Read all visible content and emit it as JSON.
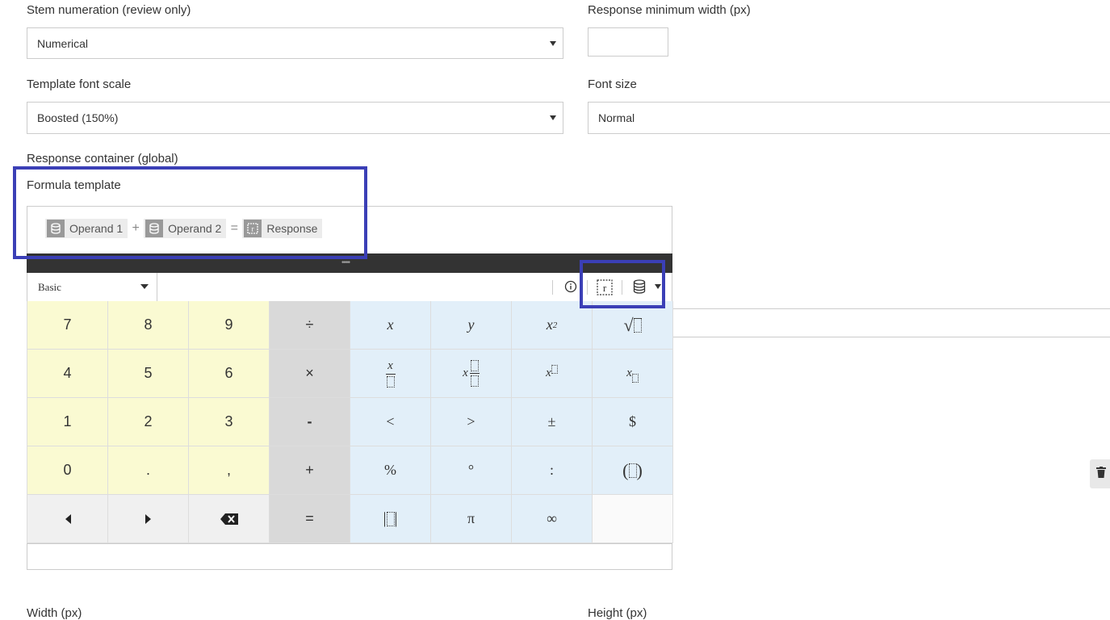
{
  "form": {
    "stem_numeration": {
      "label": "Stem numeration (review only)",
      "value": "Numerical"
    },
    "response_min_width": {
      "label": "Response minimum width (px)",
      "value": ""
    },
    "template_font_scale": {
      "label": "Template font scale",
      "value": "Boosted (150%)"
    },
    "font_size": {
      "label": "Font size",
      "value": "Normal"
    },
    "response_container": {
      "label": "Response container (global)"
    },
    "formula_template": {
      "label": "Formula template"
    },
    "width": {
      "label": "Width (px)"
    },
    "height": {
      "label": "Height (px)"
    }
  },
  "template": {
    "operand1": "Operand 1",
    "plus": "+",
    "operand2": "Operand 2",
    "equals": "=",
    "response": "Response"
  },
  "keypad": {
    "mode": "Basic",
    "grip": "••••",
    "rows": [
      [
        "7",
        "8",
        "9",
        "÷",
        "x",
        "y",
        "x²",
        "√□"
      ],
      [
        "4",
        "5",
        "6",
        "×",
        "x/□",
        "x□/□",
        "x^□",
        "x_□"
      ],
      [
        "1",
        "2",
        "3",
        "-",
        "<",
        ">",
        "±",
        "$"
      ],
      [
        "0",
        ".",
        ",",
        "+",
        "%",
        "°",
        ":",
        "(□)"
      ],
      [
        "◀",
        "▶",
        "⌫",
        "=",
        "|□|",
        "π",
        "∞",
        ""
      ]
    ]
  },
  "colors": {
    "highlight": "#3b3fb6",
    "numeric_key": "#fafad2",
    "operator_key": "#d9d9d9",
    "function_key": "#e2eff9"
  },
  "icons": [
    "database-icon",
    "response-box-icon",
    "info-icon",
    "chevron-down-icon",
    "trash-icon",
    "backspace-icon"
  ]
}
